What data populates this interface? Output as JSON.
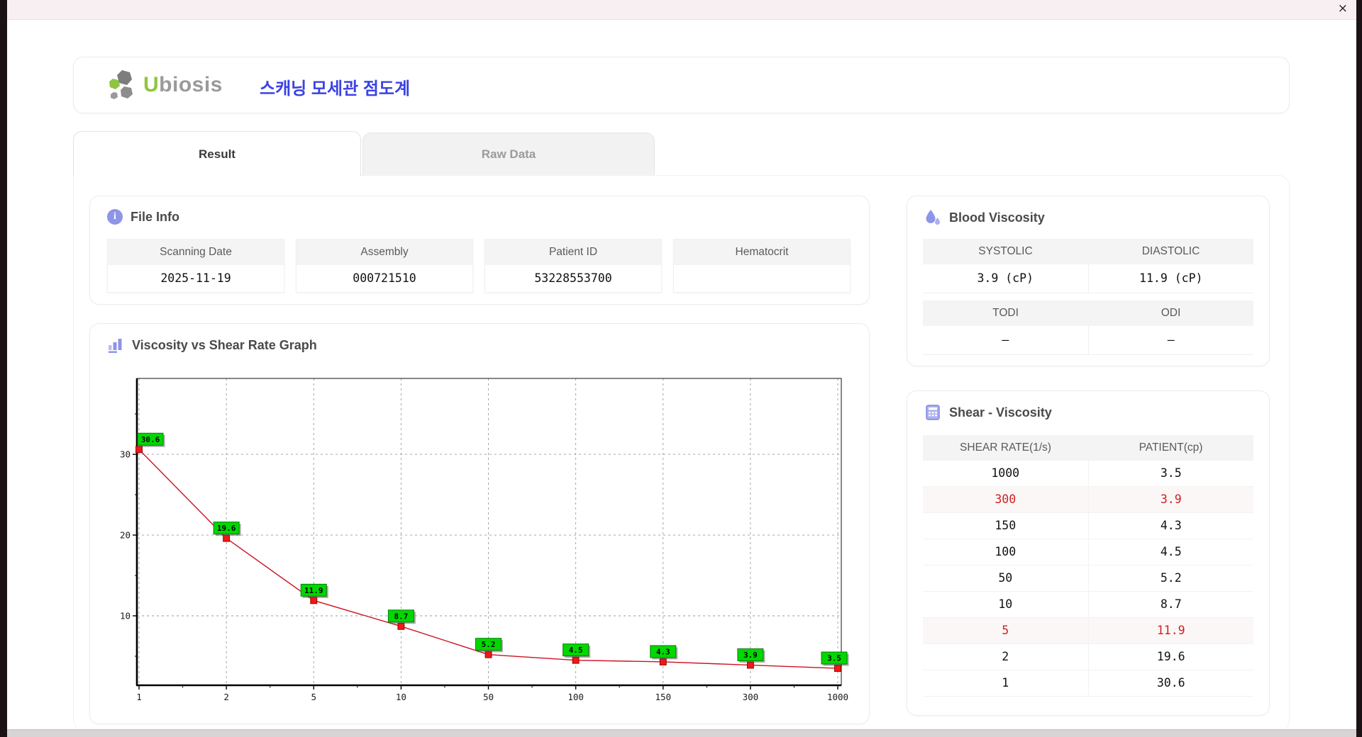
{
  "window": {
    "close_icon": "×"
  },
  "header": {
    "logo_u": "U",
    "logo_rest": "biosis",
    "app_title": "스캐닝 모세관 점도계"
  },
  "tabs": [
    {
      "label": "Result",
      "active": true
    },
    {
      "label": "Raw Data",
      "active": false
    }
  ],
  "file_info": {
    "title": "File Info",
    "fields": [
      {
        "label": "Scanning Date",
        "value": "2025-11-19"
      },
      {
        "label": "Assembly",
        "value": "000721510"
      },
      {
        "label": "Patient ID",
        "value": "53228553700"
      },
      {
        "label": "Hematocrit",
        "value": ""
      }
    ]
  },
  "blood_viscosity": {
    "title": "Blood Viscosity",
    "rows": [
      {
        "cols": [
          {
            "label": "SYSTOLIC",
            "value": "3.9 (cP)"
          },
          {
            "label": "DIASTOLIC",
            "value": "11.9 (cP)"
          }
        ]
      },
      {
        "cols": [
          {
            "label": "TODI",
            "value": "–"
          },
          {
            "label": "ODI",
            "value": "–"
          }
        ]
      }
    ]
  },
  "graph": {
    "title": "Viscosity vs Shear Rate Graph"
  },
  "chart_data": {
    "type": "line",
    "title": "Viscosity vs Shear Rate Graph",
    "categories": [
      "1",
      "2",
      "5",
      "10",
      "50",
      "100",
      "150",
      "300",
      "1000"
    ],
    "values": [
      30.6,
      19.6,
      11.9,
      8.7,
      5.2,
      4.5,
      4.3,
      3.9,
      3.5
    ],
    "point_labels": [
      "30.6",
      "19.6",
      "11.9",
      "8.7",
      "5.2",
      "4.5",
      "4.3",
      "3.9",
      "3.5"
    ],
    "yticks": [
      10,
      20,
      30
    ],
    "ylim": [
      1.4,
      39.4
    ],
    "grid": "dashed",
    "line_color": "#cc1122",
    "marker_color": "#f01818",
    "marker_border": "#8b0000",
    "label_bg": "#00d800",
    "label_border": "#0a7a0a"
  },
  "shear_viscosity": {
    "title": "Shear - Viscosity",
    "columns": [
      "SHEAR RATE(1/s)",
      "PATIENT(cp)"
    ],
    "rows": [
      {
        "shear_rate": "1000",
        "patient": "3.5",
        "highlight": false
      },
      {
        "shear_rate": "300",
        "patient": "3.9",
        "highlight": true
      },
      {
        "shear_rate": "150",
        "patient": "4.3",
        "highlight": false
      },
      {
        "shear_rate": "100",
        "patient": "4.5",
        "highlight": false
      },
      {
        "shear_rate": "50",
        "patient": "5.2",
        "highlight": false
      },
      {
        "shear_rate": "10",
        "patient": "8.7",
        "highlight": false
      },
      {
        "shear_rate": "5",
        "patient": "11.9",
        "highlight": true
      },
      {
        "shear_rate": "2",
        "patient": "19.6",
        "highlight": false
      },
      {
        "shear_rate": "1",
        "patient": "30.6",
        "highlight": false
      }
    ]
  },
  "colors": {
    "accent_purple": "#8d95e8",
    "title_blue": "#3b42e3",
    "alert_red": "#cf2121",
    "logo_green": "#8dc63f"
  }
}
